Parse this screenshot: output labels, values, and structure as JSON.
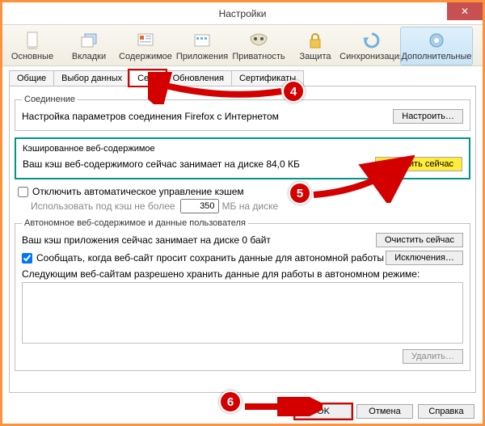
{
  "window": {
    "title": "Настройки",
    "close_glyph": "✕"
  },
  "toolbar": [
    {
      "label": "Основные"
    },
    {
      "label": "Вкладки"
    },
    {
      "label": "Содержимое"
    },
    {
      "label": "Приложения"
    },
    {
      "label": "Приватность"
    },
    {
      "label": "Защита"
    },
    {
      "label": "Синхронизация"
    },
    {
      "label": "Дополнительные"
    }
  ],
  "subtabs": [
    {
      "label": "Общие"
    },
    {
      "label": "Выбор данных"
    },
    {
      "label": "Сеть"
    },
    {
      "label": "Обновления"
    },
    {
      "label": "Сертификаты"
    }
  ],
  "connection": {
    "legend": "Соединение",
    "text": "Настройка параметров соединения Firefox с Интернетом",
    "button": "Настроить…"
  },
  "cache": {
    "title": "Кэшированное веб-содержимое",
    "text": "Ваш кэш веб-содержимого сейчас занимает на диске 84,0 КБ",
    "clear": "Очистить сейчас",
    "cb_label": "Отключить автоматическое управление кэшем",
    "limit_prefix": "Использовать под кэш не более",
    "limit_value": "350",
    "limit_suffix": "МБ на диске"
  },
  "offline": {
    "legend": "Автономное веб-содержимое и данные пользователя",
    "text": "Ваш кэш приложения сейчас занимает на диске 0 байт",
    "clear": "Очистить сейчас",
    "cb_label": "Сообщать, когда веб-сайт просит сохранить данные для автономной работы",
    "exceptions": "Исключения…",
    "list_label": "Следующим веб-сайтам разрешено хранить данные для работы в автономном режиме:",
    "delete": "Удалить…"
  },
  "bottom": {
    "ok": "OK",
    "cancel": "Отмена",
    "help": "Справка"
  },
  "markers": {
    "m4": "4",
    "m5": "5",
    "m6": "6"
  }
}
